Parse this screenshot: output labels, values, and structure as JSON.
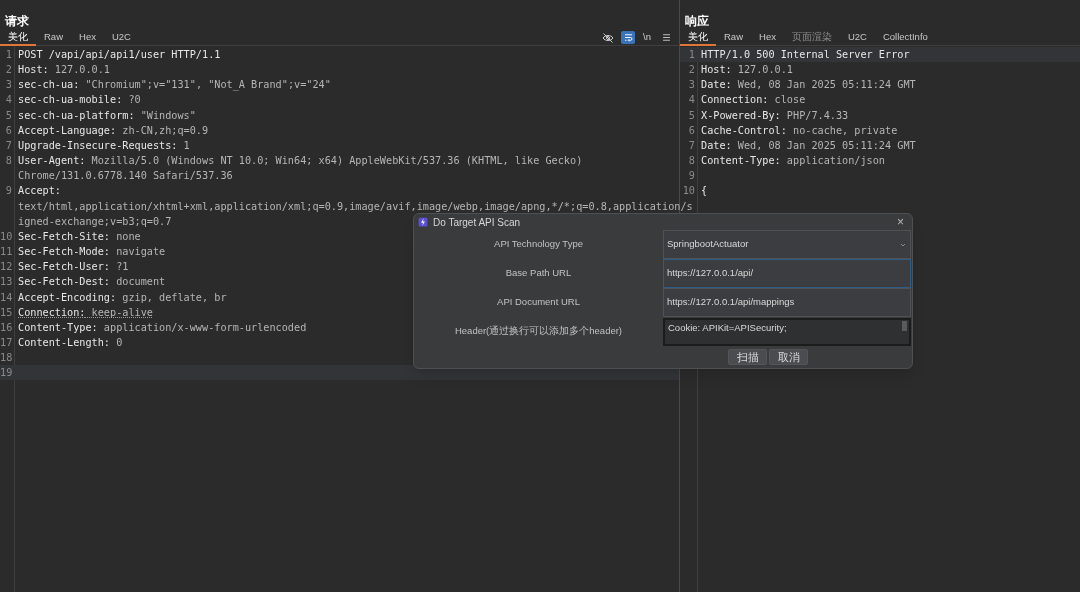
{
  "request": {
    "title": "请求",
    "tabs": [
      {
        "label": "美化",
        "selected": true,
        "disabled": false
      },
      {
        "label": "Raw",
        "selected": false,
        "disabled": false
      },
      {
        "label": "Hex",
        "selected": false,
        "disabled": false
      },
      {
        "label": "U2C",
        "selected": false,
        "disabled": false
      }
    ],
    "toolbar": [
      {
        "kind": "hide",
        "on": false
      },
      {
        "kind": "wrap",
        "on": true
      },
      {
        "kind": "text",
        "label": "\\n",
        "on": false
      },
      {
        "kind": "menu",
        "on": false
      }
    ],
    "lines": [
      {
        "num": "1",
        "key": "POST /vapi/api/api1/user HTTP/1.1",
        "underlined": false,
        "current": false
      },
      {
        "num": "2",
        "key": "Host:",
        "value": " 127.0.0.1",
        "underlined": false,
        "current": false
      },
      {
        "num": "3",
        "key": "sec-ch-ua:",
        "value": " \"Chromium\";v=\"131\", \"Not_A Brand\";v=\"24\"",
        "underlined": false,
        "current": false
      },
      {
        "num": "4",
        "key": "sec-ch-ua-mobile:",
        "value": " ?0",
        "underlined": false,
        "current": false
      },
      {
        "num": "5",
        "key": "sec-ch-ua-platform:",
        "value": " \"Windows\"",
        "underlined": false,
        "current": false
      },
      {
        "num": "6",
        "key": "Accept-Language:",
        "value": " zh-CN,zh;q=0.9",
        "underlined": false,
        "current": false
      },
      {
        "num": "7",
        "key": "Upgrade-Insecure-Requests:",
        "value": " 1",
        "underlined": false,
        "current": false
      },
      {
        "num": "8",
        "key": "User-Agent:",
        "value": " Mozilla/5.0 (Windows NT 10.0; Win64; x64) AppleWebKit/537.36 (KHTML, like Gecko)",
        "wrap": [
          "Chrome/131.0.6778.140 Safari/537.36"
        ],
        "underlined": false,
        "current": false
      },
      {
        "num": "9",
        "key": "Accept:",
        "wrap": [
          "text/html,application/xhtml+xml,application/xml;q=0.9,image/avif,image/webp,image/apng,*/*;q=0.8,application/s",
          "igned-exchange;v=b3;q=0.7"
        ],
        "underlined": false,
        "current": false
      },
      {
        "num": "10",
        "key": "Sec-Fetch-Site:",
        "value": " none",
        "underlined": false,
        "current": false
      },
      {
        "num": "11",
        "key": "Sec-Fetch-Mode:",
        "value": " navigate",
        "underlined": false,
        "current": false
      },
      {
        "num": "12",
        "key": "Sec-Fetch-User:",
        "value": " ?1",
        "underlined": false,
        "current": false
      },
      {
        "num": "13",
        "key": "Sec-Fetch-Dest:",
        "value": " document",
        "underlined": false,
        "current": false
      },
      {
        "num": "14",
        "key": "Accept-Encoding:",
        "value": " gzip, deflate, br",
        "underlined": false,
        "current": false
      },
      {
        "num": "15",
        "key": "Connection:",
        "value": " keep-alive",
        "underlined": true,
        "current": false
      },
      {
        "num": "16",
        "key": "Content-Type:",
        "value": " application/x-www-form-urlencoded",
        "underlined": false,
        "current": false
      },
      {
        "num": "17",
        "key": "Content-Length:",
        "value": " 0",
        "underlined": false,
        "current": false
      },
      {
        "num": "18",
        "underlined": false,
        "current": false
      },
      {
        "num": "19",
        "underlined": false,
        "current": true
      }
    ]
  },
  "response": {
    "title": "响应",
    "tabs": [
      {
        "label": "美化",
        "selected": true,
        "disabled": false
      },
      {
        "label": "Raw",
        "selected": false,
        "disabled": false
      },
      {
        "label": "Hex",
        "selected": false,
        "disabled": false
      },
      {
        "label": "页面渲染",
        "selected": false,
        "disabled": true
      },
      {
        "label": "U2C",
        "selected": false,
        "disabled": false
      },
      {
        "label": "CollectInfo",
        "selected": false,
        "disabled": false
      }
    ],
    "lines": [
      {
        "num": "1",
        "key": "HTTP/1.0 500 Internal Server Error",
        "current": true
      },
      {
        "num": "2",
        "key": "Host:",
        "value": " 127.0.0.1",
        "current": false
      },
      {
        "num": "3",
        "key": "Date:",
        "value": " Wed, 08 Jan 2025 05:11:24 GMT",
        "current": false
      },
      {
        "num": "4",
        "key": "Connection:",
        "value": " close",
        "current": false
      },
      {
        "num": "5",
        "key": "X-Powered-By:",
        "value": " PHP/7.4.33",
        "current": false
      },
      {
        "num": "6",
        "key": "Cache-Control:",
        "value": " no-cache, private",
        "current": false
      },
      {
        "num": "7",
        "key": "Date:",
        "value": " Wed, 08 Jan 2025 05:11:24 GMT",
        "current": false
      },
      {
        "num": "8",
        "key": "Content-Type:",
        "value": " application/json",
        "current": false
      },
      {
        "num": "9",
        "current": false
      },
      {
        "num": "10",
        "key": "{",
        "current": false
      }
    ]
  },
  "dialog": {
    "title": "Do Target API Scan",
    "close": "×",
    "fields": [
      {
        "kind": "select",
        "label": "API Technology Type",
        "value": "SpringbootActuator",
        "focused": false
      },
      {
        "kind": "text",
        "label": "Base Path URL",
        "value": "https://127.0.0.1/api/",
        "focused": true
      },
      {
        "kind": "text",
        "label": "API Document URL",
        "value": "https://127.0.0.1/api/mappings",
        "focused": false
      },
      {
        "kind": "textarea",
        "label": "Header(通过换行可以添加多个header)",
        "value": "Cookie: APIKit=APISecurity;",
        "focused": false
      }
    ],
    "buttons": [
      "扫描",
      "取消"
    ]
  }
}
